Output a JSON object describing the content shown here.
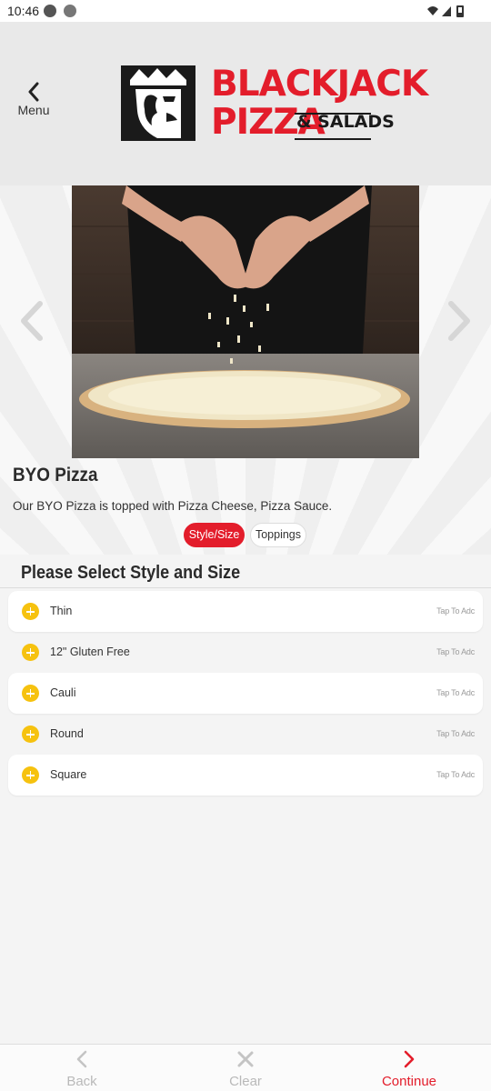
{
  "status_bar": {
    "time": "10:46"
  },
  "header": {
    "menu_label": "Menu",
    "logo": {
      "line1": "BLACKJACK",
      "line2": "PIZZA",
      "sub": "& SALADS"
    }
  },
  "item": {
    "title": "BYO Pizza",
    "description": "Our BYO Pizza is topped with Pizza Cheese, Pizza Sauce.",
    "tabs": [
      {
        "label": "Style/Size",
        "active": true
      },
      {
        "label": "Toppings",
        "active": false
      }
    ]
  },
  "section": {
    "title": "Please Select Style and Size"
  },
  "options": [
    {
      "label": "Thin",
      "hint": "Tap To Adc"
    },
    {
      "label": "12\" Gluten Free",
      "hint": "Tap To Adc"
    },
    {
      "label": "Cauli",
      "hint": "Tap To Adc"
    },
    {
      "label": "Round",
      "hint": "Tap To Adc"
    },
    {
      "label": "Square",
      "hint": "Tap To Adc"
    }
  ],
  "bottom_bar": {
    "back_label": "Back",
    "clear_label": "Clear",
    "continue_label": "Continue"
  },
  "colors": {
    "accent": "#e31d2b",
    "plus": "#f6c20f",
    "muted": "#b9b9b9"
  }
}
